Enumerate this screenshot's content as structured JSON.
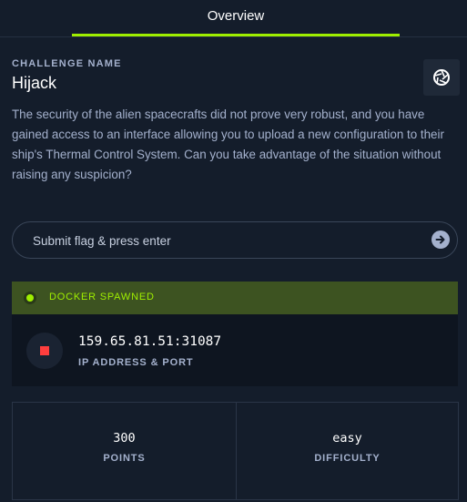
{
  "tabs": [
    {
      "label": "Overview",
      "active": true
    }
  ],
  "challenge": {
    "name_label": "CHALLENGE NAME",
    "name": "Hijack",
    "action_icon": "aperture-icon",
    "description": "The security of the alien spacecrafts did not prove very robust, and you have gained access to an interface allowing you to upload a new configuration to their ship's Thermal Control System. Can you take advantage of the situation without raising any suspicion?"
  },
  "flag": {
    "placeholder": "Submit flag & press enter",
    "value": "",
    "submit_icon": "arrow-right-circle-icon"
  },
  "docker": {
    "status": "DOCKER SPAWNED",
    "ip": "159.65.81.51:31087",
    "ip_label": "IP ADDRESS & PORT",
    "stop_icon": "stop-icon"
  },
  "stats": {
    "points": "300",
    "points_label": "POINTS",
    "difficulty": "easy",
    "difficulty_label": "DIFFICULTY"
  },
  "colors": {
    "background": "#141d2b",
    "accent": "#9fef00",
    "muted_text": "#a4b1cd",
    "docker_bar": "#3d5321",
    "stop": "#ff3e3e"
  }
}
